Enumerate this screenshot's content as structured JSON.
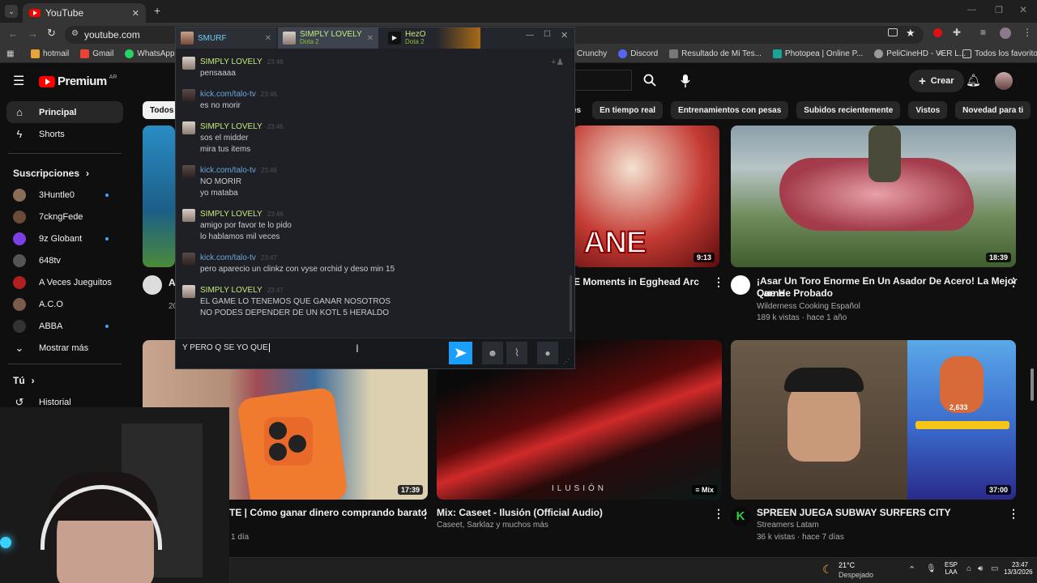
{
  "browser": {
    "tab_title": "YouTube",
    "url": "youtube.com",
    "bookmarks": [
      "hotmail",
      "Gmail",
      "WhatsApp",
      "Crunchy",
      "Discord",
      "Resultado de Mi Tes...",
      "Photopea | Online P...",
      "PeliCineHD - VER L..."
    ],
    "all_bookmarks": "Todos los favoritos"
  },
  "youtube": {
    "logo": "Premium",
    "region": "AR",
    "create": "Crear",
    "chips": [
      "Todos",
      "es",
      "En tiempo real",
      "Entrenamientos con pesas",
      "Subidos recientemente",
      "Vistos",
      "Novedad para ti"
    ],
    "sidebar": {
      "main": [
        {
          "label": "Principal"
        },
        {
          "label": "Shorts"
        }
      ],
      "subs_title": "Suscripciones",
      "subs": [
        {
          "label": "3Huntle0",
          "dot": true,
          "color": "#8a6e5a"
        },
        {
          "label": "7ckngFede",
          "dot": false,
          "color": "#6b4a3a"
        },
        {
          "label": "9z Globant",
          "dot": true,
          "color": "#7b3fe4"
        },
        {
          "label": "648tv",
          "dot": false,
          "color": "#555555"
        },
        {
          "label": "A Veces Jueguitos",
          "dot": false,
          "color": "#b02020"
        },
        {
          "label": "A.C.O",
          "dot": false,
          "color": "#7a5a4a"
        },
        {
          "label": "ABBA",
          "dot": true,
          "color": "#333333"
        }
      ],
      "more": "Mostrar más",
      "you": "Tú",
      "history": "Historial"
    },
    "videos": [
      {
        "title": "E Moments in Egghead Arc",
        "meta1": "",
        "meta2": "",
        "duration": "9:13"
      },
      {
        "title": "¡Asar Un Toro Enorme En Un Asador De Acero! La Mejor Carne",
        "title2": "Que He Probado",
        "meta1": "Wilderness Cooking Español",
        "meta2": "189 k vistas · hace 1 año",
        "duration": "18:39"
      },
      {
        "title": "TE | Cómo ganar dinero comprando barato",
        "meta1": "",
        "meta2": "1 día",
        "duration": "17:39"
      },
      {
        "title": "Mix: Caseet - Ilusión (Official Audio)",
        "meta1": "Caseet, Sarklaz y muchos más",
        "meta2": "",
        "duration": "Mix",
        "overlay": "ILUSIÓN"
      },
      {
        "title": "SPREEN JUEGA SUBWAY SURFERS CITY",
        "meta1": "Streamers Latam",
        "meta2": "36 k vistas · hace 7 días",
        "duration": "37:00"
      }
    ],
    "anime_text": "ANE",
    "partial_meta": "20",
    "partial_letter": "A",
    "game_score": "2,633"
  },
  "chat": {
    "tabs": [
      {
        "name": "SMURF",
        "game": ""
      },
      {
        "name": "SIMPLY LOVELY",
        "game": "Dota 2"
      },
      {
        "name": "HezO",
        "game": "Dota 2"
      }
    ],
    "messages": [
      {
        "user": "SIMPLY LOVELY",
        "time": "23:46",
        "lines": [
          "pensaaaa"
        ],
        "self": true
      },
      {
        "user": "kick.com/talo-tv",
        "time": "23:46",
        "lines": [
          "es no morir"
        ],
        "self": false
      },
      {
        "user": "SIMPLY LOVELY",
        "time": "23:46",
        "lines": [
          "sos el midder",
          "mira tus items"
        ],
        "self": true
      },
      {
        "user": "kick.com/talo-tv",
        "time": "23:46",
        "lines": [
          "NO MORIR",
          "yo mataba"
        ],
        "self": false
      },
      {
        "user": "SIMPLY LOVELY",
        "time": "23:46",
        "lines": [
          "amigo por favor te lo pido",
          "lo hablamos mil veces"
        ],
        "self": true
      },
      {
        "user": "kick.com/talo-tv",
        "time": "23:47",
        "lines": [
          "pero aparecio un clinkz con vyse orchid y deso min 15"
        ],
        "self": false
      },
      {
        "user": "SIMPLY LOVELY",
        "time": "23:47",
        "lines": [
          "EL GAME LO TENEMOS QUE GANAR NOSOTROS",
          "NO PODES DEPENDER DE UN KOTL 5 HERALDO"
        ],
        "self": true
      }
    ],
    "input_value": "Y PERO Q SE YO QUE"
  },
  "taskbar": {
    "weather_temp": "21°C",
    "weather_desc": "Despejado",
    "lang1": "ESP",
    "lang2": "LAA",
    "time": "23:47",
    "date": "13/3/2026"
  },
  "colors": {
    "self_user": "#c8e97a",
    "other_user": "#6aa7d8",
    "send": "#1a9fff",
    "yt_red": "#ff0000"
  }
}
